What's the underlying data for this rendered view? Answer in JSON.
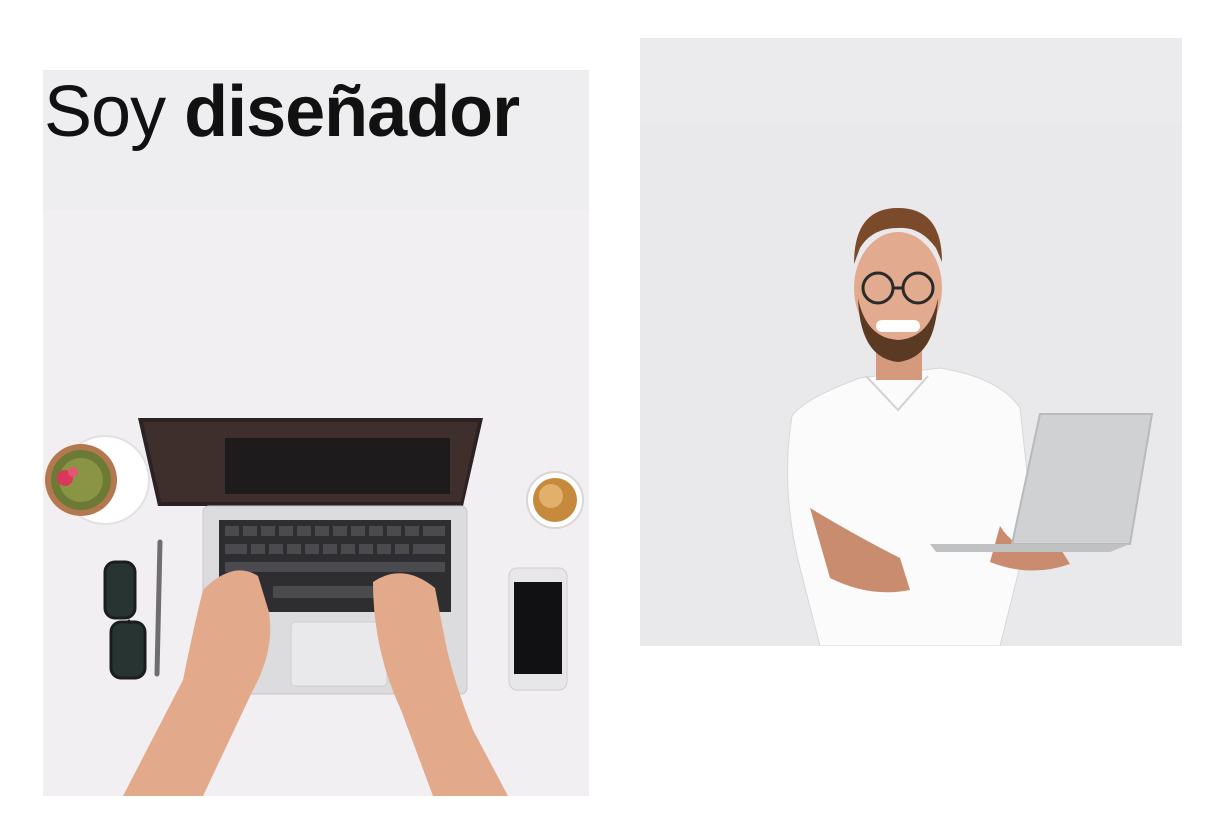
{
  "hero": {
    "headline_light": "Soy",
    "headline_bold": "diseñador"
  },
  "images": {
    "left": "desk-laptop-photo",
    "right": "man-with-laptop-photo"
  },
  "colors": {
    "background": "#ffffff",
    "panel": "#efeef1",
    "text": "#111111"
  }
}
